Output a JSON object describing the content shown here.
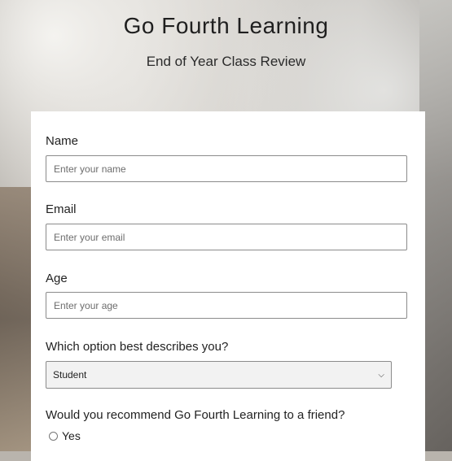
{
  "header": {
    "title": "Go Fourth Learning",
    "subtitle": "End of Year Class Review"
  },
  "form": {
    "name": {
      "label": "Name",
      "placeholder": "Enter your name",
      "value": ""
    },
    "email": {
      "label": "Email",
      "placeholder": "Enter your email",
      "value": ""
    },
    "age": {
      "label": "Age",
      "placeholder": "Enter your age",
      "value": ""
    },
    "role": {
      "label": "Which option best describes you?",
      "selected": "Student"
    },
    "recommend": {
      "label": "Would you recommend Go Fourth Learning to a friend?",
      "options": [
        {
          "label": "Yes",
          "checked": false
        }
      ]
    }
  }
}
